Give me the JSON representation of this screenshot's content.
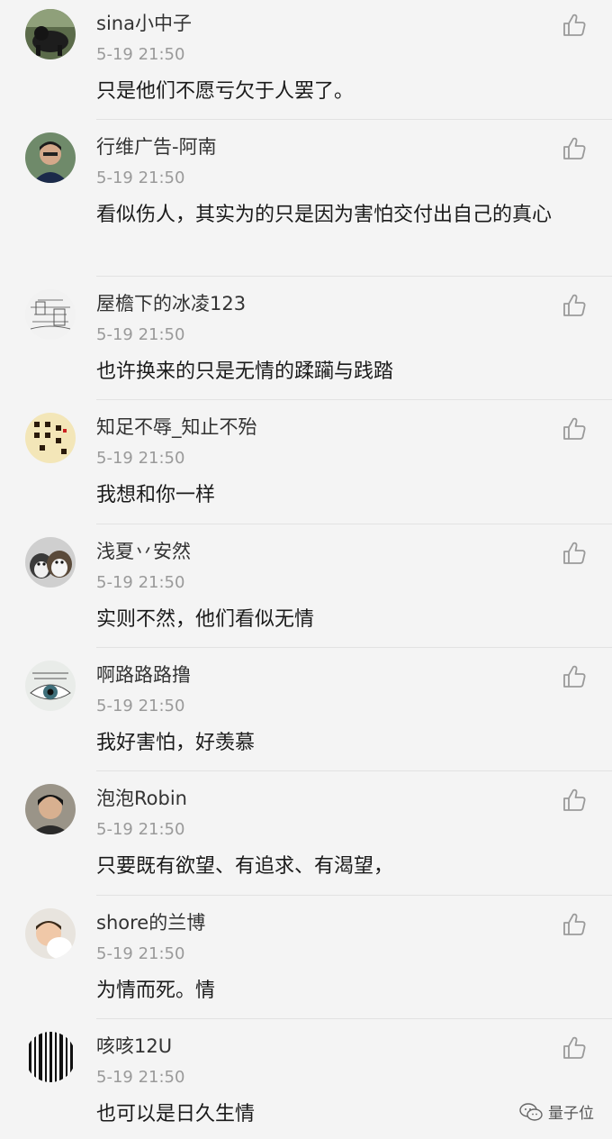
{
  "comments": [
    {
      "username": "sina小中子",
      "time": "5-19 21:50",
      "text": "只是他们不愿亏欠于人罢了。",
      "avatar": "dark-animal-photo"
    },
    {
      "username": "行维广告-阿南",
      "time": "5-19 21:50",
      "text": "看似伤人，其实为的只是因为害怕交付出自己的真心",
      "avatar": "man-portrait-photo"
    },
    {
      "username": "屋檐下的冰凌123",
      "time": "5-19 21:50",
      "text": "也许换来的只是无情的蹂躏与践踏",
      "avatar": "sketch-drawing"
    },
    {
      "username": "知足不辱_知止不殆",
      "time": "5-19 21:50",
      "text": "我想和你一样",
      "avatar": "calligraphy-text"
    },
    {
      "username": "浅夏丷安然",
      "time": "5-19 21:50",
      "text": "实则不然，他们看似无情",
      "avatar": "husky-dogs-photo"
    },
    {
      "username": "啊路路路撸",
      "time": "5-19 21:50",
      "text": "我好害怕，好羡慕",
      "avatar": "eye-closeup"
    },
    {
      "username": "泡泡Robin",
      "time": "5-19 21:50",
      "text": "只要既有欲望、有追求、有渴望，",
      "avatar": "person-portrait-photo"
    },
    {
      "username": "shore的兰博",
      "time": "5-19 21:50",
      "text": "为情而死。情",
      "avatar": "child-photo"
    },
    {
      "username": "咳咳12U",
      "time": "5-19 21:50",
      "text": "也可以是日久生情",
      "avatar": "black-white-stripes"
    }
  ],
  "icons": {
    "like": "thumbs-up-icon",
    "watermark": "wechat-icon"
  },
  "watermark": {
    "label": "量子位"
  },
  "colors": {
    "background": "#f4f4f4",
    "text": "#1a1a1a",
    "username": "#333333",
    "time": "#9a9a9a",
    "divider": "#e2e2e2",
    "icon": "#999999"
  }
}
